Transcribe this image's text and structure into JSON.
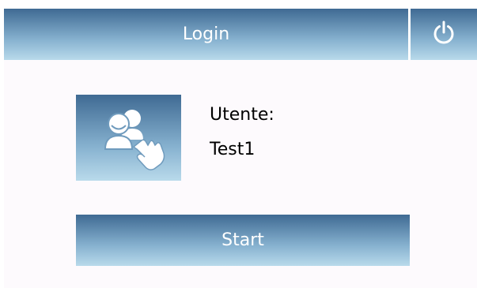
{
  "header": {
    "title": "Login",
    "power_icon": "power-icon"
  },
  "user_tile": {
    "icon": "users-touch-icon"
  },
  "user": {
    "label": "Utente:",
    "value": "Test1"
  },
  "start_button": {
    "label": "Start"
  },
  "colors": {
    "gradient_top": "#3f6a93",
    "gradient_mid": "#86b1cf",
    "gradient_bottom": "#b9daeb",
    "background": "#fdfafd"
  }
}
